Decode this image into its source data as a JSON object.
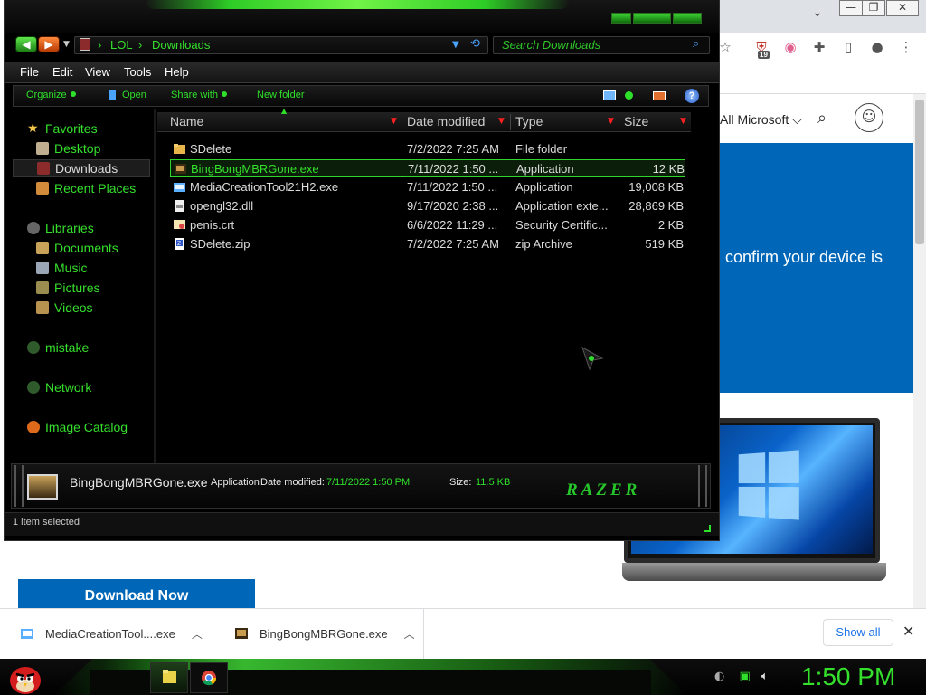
{
  "explorer": {
    "address": [
      "LOL",
      "Downloads"
    ],
    "search_placeholder": "Search Downloads",
    "menu": [
      "File",
      "Edit",
      "View",
      "Tools",
      "Help"
    ],
    "commands": {
      "organize": "Organize",
      "open": "Open",
      "share": "Share with",
      "new_folder": "New folder"
    },
    "nav": {
      "favorites": "Favorites",
      "desktop": "Desktop",
      "downloads": "Downloads",
      "recent": "Recent Places",
      "libraries": "Libraries",
      "documents": "Documents",
      "music": "Music",
      "pictures": "Pictures",
      "videos": "Videos",
      "mistake": "mistake",
      "network": "Network",
      "image_catalog": "Image Catalog"
    },
    "columns": {
      "name": "Name",
      "date": "Date modified",
      "type": "Type",
      "size": "Size"
    },
    "files": [
      {
        "name": "SDelete",
        "date": "7/2/2022 7:25 AM",
        "type": "File folder",
        "size": "",
        "icon": "folder-icon"
      },
      {
        "name": "BingBongMBRGone.exe",
        "date": "7/11/2022 1:50 ...",
        "type": "Application",
        "size": "12 KB",
        "icon": "exe-icon"
      },
      {
        "name": "MediaCreationTool21H2.exe",
        "date": "7/11/2022 1:50 ...",
        "type": "Application",
        "size": "19,008 KB",
        "icon": "installer-icon"
      },
      {
        "name": "opengl32.dll",
        "date": "9/17/2020 2:38 ...",
        "type": "Application exte...",
        "size": "28,869 KB",
        "icon": "dll-icon"
      },
      {
        "name": "penis.crt",
        "date": "6/6/2022 11:29 ...",
        "type": "Security Certific...",
        "size": "2 KB",
        "icon": "certificate-icon"
      },
      {
        "name": "SDelete.zip",
        "date": "7/2/2022 7:25 AM",
        "type": "zip Archive",
        "size": "519 KB",
        "icon": "zip-icon"
      }
    ],
    "details": {
      "name": "BingBongMBRGone.exe",
      "type": "Application",
      "modified_label": "Date modified:",
      "modified_value": "7/11/2022 1:50 PM",
      "size_label": "Size:",
      "size_value": "11.5 KB",
      "brand": "RAZER"
    },
    "status": "1 item selected"
  },
  "browser": {
    "all_microsoft": "All Microsoft ⌵",
    "hero_text": "confirm your device is",
    "download_button": "Download Now",
    "extension_badge": "19"
  },
  "downloads_shelf": {
    "items": [
      {
        "name": "MediaCreationTool....exe"
      },
      {
        "name": "BingBongMBRGone.exe"
      }
    ],
    "show_all": "Show all"
  },
  "taskbar": {
    "clock": "1:50 PM"
  },
  "colors": {
    "accent_green": "#35e02c",
    "ms_blue": "#0067b8",
    "window_bg": "#000000"
  }
}
